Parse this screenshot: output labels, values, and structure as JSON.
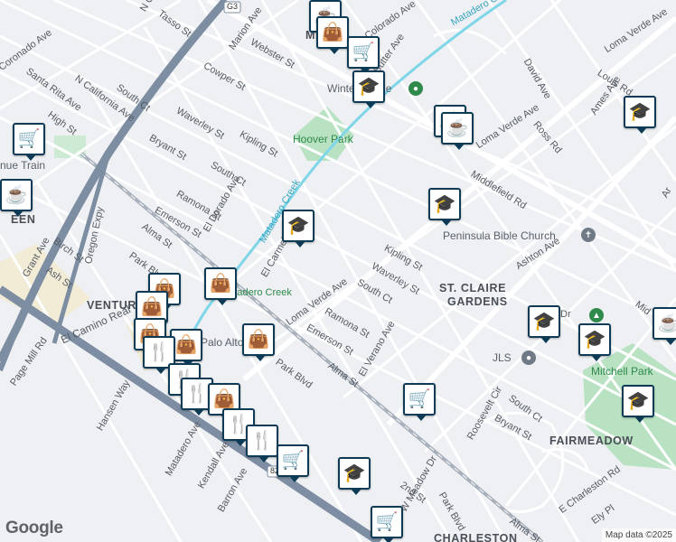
{
  "map": {
    "attribution": "Map data ©2025",
    "logo": "Google",
    "colors": {
      "background": "#eef0f3",
      "street": "#ffffff",
      "highway": "#7d8ea3",
      "rail": "#a7b0bb",
      "canal": "#7fd6e8",
      "park": "#b9e2c3",
      "marker_border": "#0d3b56"
    }
  },
  "areas": [
    {
      "name": "MIDTOWN",
      "shown": "MIDTO"
    },
    {
      "name": "ST. CLAIRE GARDENS_1",
      "shown": "ST. CLAIRE"
    },
    {
      "name": "ST. CLAIRE GARDENS_2",
      "shown": "GARDENS"
    },
    {
      "name": "VENTURA",
      "shown": "VENTUR"
    },
    {
      "name": "FAIRMEADOW",
      "shown": "FAIRMEADOW"
    },
    {
      "name": "CHARLESTON",
      "shown": "CHARLESTON"
    },
    {
      "name": "GREEN",
      "shown": "EEN"
    }
  ],
  "parks": [
    "Hoover Park",
    "Mitchell Park",
    "Matadero Creek"
  ],
  "pois": [
    "Peninsula Bible Church",
    "JLS",
    "Palo Alto",
    "Winter Lodge",
    "nue Train"
  ],
  "shields": [
    "G3",
    "82"
  ],
  "streets": [
    "Middlefield Rd",
    "Loma Verde Ave",
    "Louis Rd",
    "David Ave",
    "Ross Rd",
    "Ames Ave",
    "Matadero Canal",
    "Sutter Ave",
    "Colorado Ave",
    "Webster St",
    "Marion Ave",
    "Cowper St",
    "Waverley St",
    "Kipling St",
    "South Ct",
    "Bryant St",
    "Ramona St",
    "Emerson St",
    "El Dorado Ave",
    "El Carmelo Ave",
    "Alma St",
    "Park Blvd",
    "Oregon Expy",
    "Birch St",
    "Ash St",
    "Grant Ave",
    "High St",
    "N California Ave",
    "South Ct",
    "Santa Rita Ave",
    "Tasso St",
    "N C",
    "Page Mill Rd",
    "El Camino Real",
    "Hansen Way",
    "Matadero Ave",
    "Kendall Ave",
    "Barron Ave",
    "Ashton Ave",
    "El Verano Ave",
    "Roosevelt Cir",
    "E Charleston Rd",
    "Ely Pl",
    "W Meadow Dr",
    "2nd St",
    "Dr",
    "Mid",
    "Ar",
    "Coronado Ave",
    "Matadero Creek"
  ],
  "markers": [
    {
      "type": "cafe",
      "icon": "cup-icon"
    },
    {
      "type": "grocery",
      "icon": "cart-icon"
    },
    {
      "type": "shopping",
      "icon": "bag-icon"
    },
    {
      "type": "school",
      "icon": "grad-cap-icon"
    },
    {
      "type": "restaurant",
      "icon": "fork-knife-icon"
    }
  ]
}
